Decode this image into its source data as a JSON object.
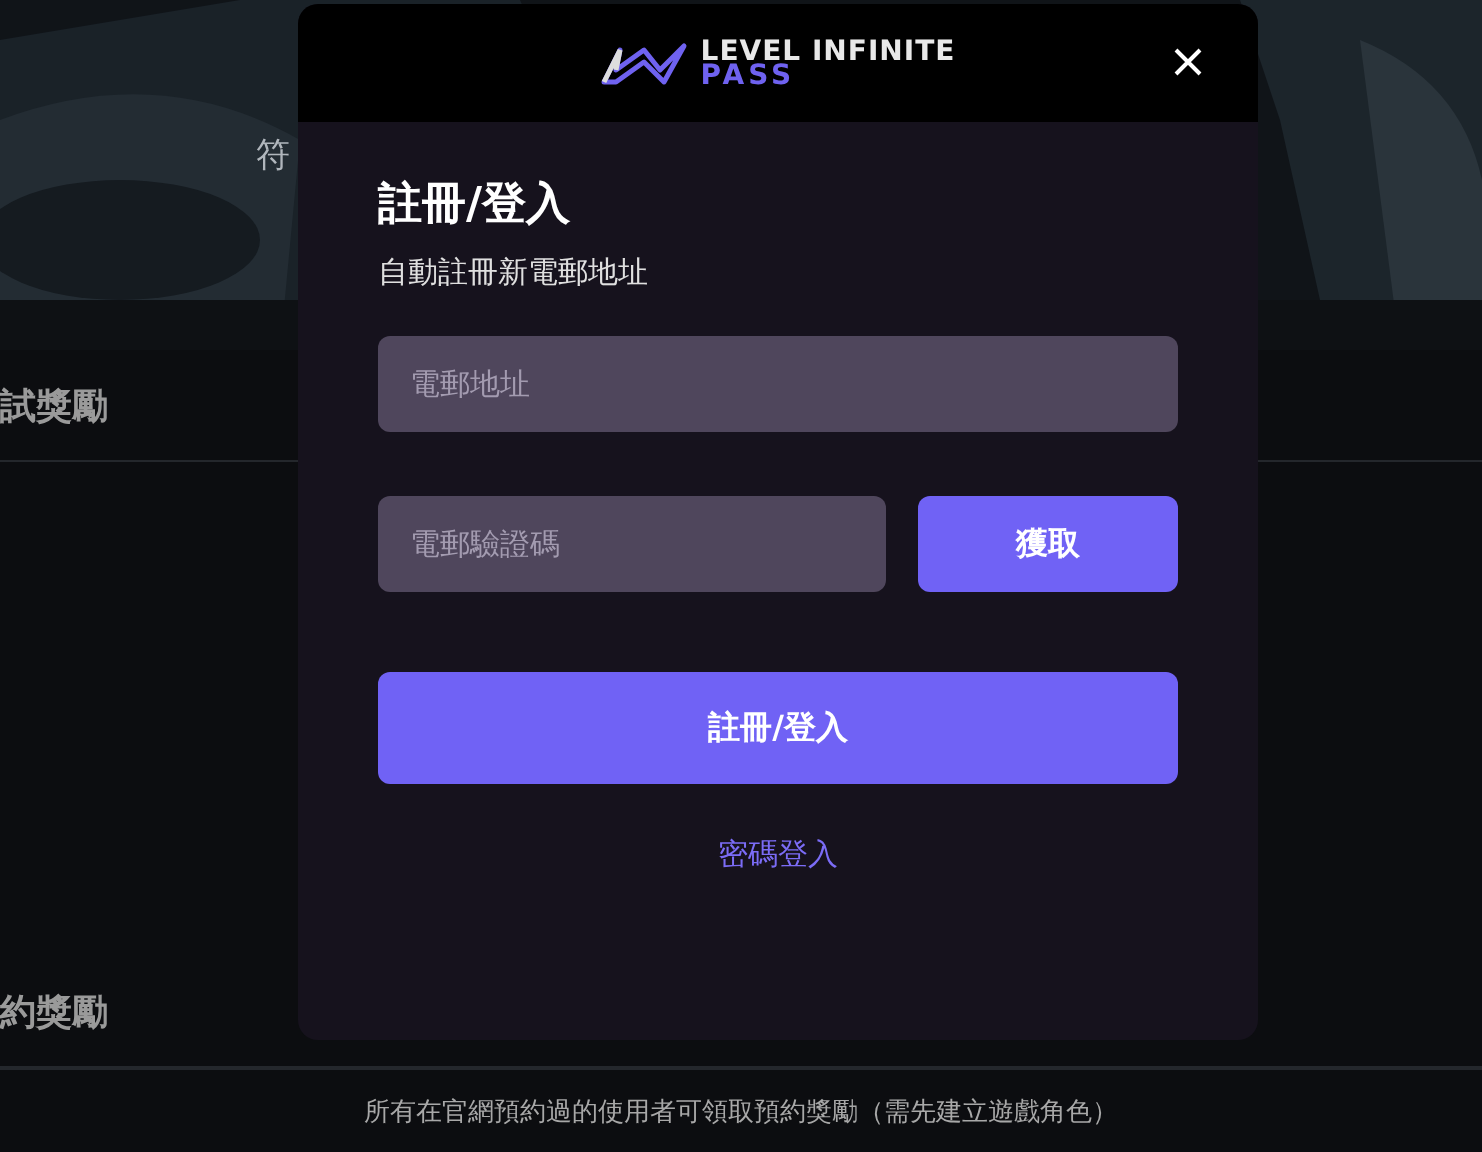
{
  "background": {
    "note_char": "符",
    "section_1": "試獎勵",
    "section_2": "約獎勵",
    "footer": "所有在官網預約過的使用者可領取預約獎勵（需先建立遊戲角色）"
  },
  "modal": {
    "logo": {
      "line_1": "LEVEL INFINITE",
      "line_2": "PASS"
    },
    "title": "註冊/登入",
    "subtitle": "自動註冊新電郵地址",
    "email": {
      "placeholder": "電郵地址"
    },
    "code": {
      "placeholder": "電郵驗證碼"
    },
    "get_code_button": "獲取",
    "submit_button": "註冊/登入",
    "password_login_link": "密碼登入"
  }
}
